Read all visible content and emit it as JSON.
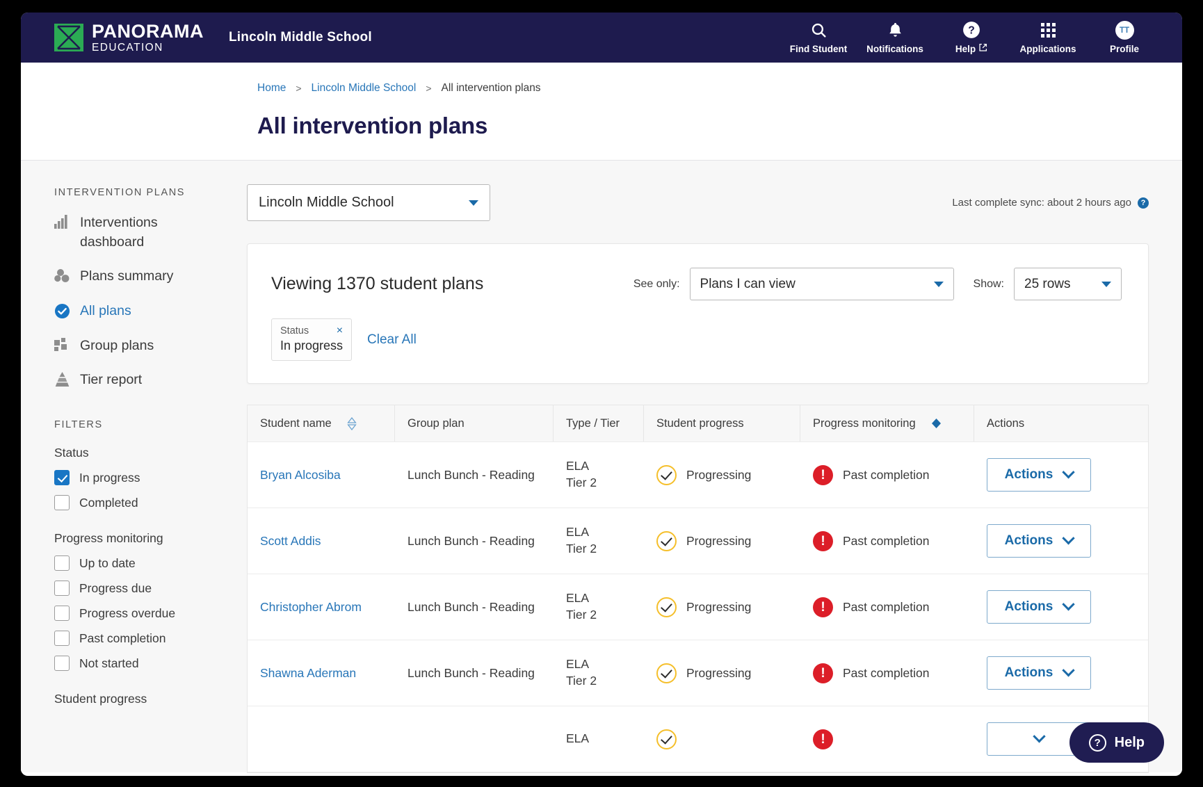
{
  "topnav": {
    "logo_line1": "PANORAMA",
    "logo_line2": "EDUCATION",
    "school": "Lincoln Middle School",
    "items": [
      {
        "icon": "search-icon",
        "label": "Find Student"
      },
      {
        "icon": "bell-icon",
        "label": "Notifications"
      },
      {
        "icon": "help-circle-icon",
        "label": "Help"
      },
      {
        "icon": "grid-icon",
        "label": "Applications"
      },
      {
        "icon": "avatar-icon",
        "label": "Profile",
        "initials": "TT"
      }
    ]
  },
  "breadcrumb": {
    "home": "Home",
    "school": "Lincoln Middle School",
    "current": "All intervention plans",
    "separator": ">"
  },
  "page_title": "All intervention plans",
  "sidebar": {
    "section_label": "INTERVENTION PLANS",
    "items": [
      {
        "label": "Interventions dashboard",
        "icon": "bar-chart-icon",
        "active": false
      },
      {
        "label": "Plans summary",
        "icon": "circles-icon",
        "active": false
      },
      {
        "label": "All plans",
        "icon": "check-circle-icon",
        "active": true
      },
      {
        "label": "Group plans",
        "icon": "squares-icon",
        "active": false
      },
      {
        "label": "Tier report",
        "icon": "pyramid-icon",
        "active": false
      }
    ],
    "filters_label": "FILTERS",
    "filter_groups": [
      {
        "title": "Status",
        "options": [
          {
            "label": "In progress",
            "checked": true
          },
          {
            "label": "Completed",
            "checked": false
          }
        ]
      },
      {
        "title": "Progress monitoring",
        "options": [
          {
            "label": "Up to date",
            "checked": false
          },
          {
            "label": "Progress due",
            "checked": false
          },
          {
            "label": "Progress overdue",
            "checked": false
          },
          {
            "label": "Past completion",
            "checked": false
          },
          {
            "label": "Not started",
            "checked": false
          }
        ]
      },
      {
        "title": "Student progress",
        "options": []
      }
    ]
  },
  "main": {
    "school_select": {
      "value": "Lincoln Middle School"
    },
    "sync_text": "Last complete sync: about 2 hours ago",
    "viewing": "Viewing 1370 student plans",
    "see_only_label": "See only:",
    "see_only_value": "Plans I can view",
    "show_label": "Show:",
    "show_value": "25 rows",
    "chip": {
      "key": "Status",
      "value": "In progress",
      "close": "×"
    },
    "clear_all": "Clear All",
    "columns": [
      {
        "label": "Student name",
        "sortable": true,
        "sort_active": false
      },
      {
        "label": "Group plan",
        "sortable": false,
        "sort_active": false
      },
      {
        "label": "Type / Tier",
        "sortable": false,
        "sort_active": false
      },
      {
        "label": "Student progress",
        "sortable": false,
        "sort_active": false
      },
      {
        "label": "Progress monitoring",
        "sortable": true,
        "sort_active": true
      },
      {
        "label": "Actions",
        "sortable": false,
        "sort_active": false
      }
    ],
    "rows": [
      {
        "student": "Bryan Alcosiba",
        "group_plan": "Lunch Bunch - Reading",
        "type": "ELA",
        "tier": "Tier 2",
        "progress": "Progressing",
        "monitoring": "Past completion",
        "action": "Actions"
      },
      {
        "student": "Scott Addis",
        "group_plan": "Lunch Bunch - Reading",
        "type": "ELA",
        "tier": "Tier 2",
        "progress": "Progressing",
        "monitoring": "Past completion",
        "action": "Actions"
      },
      {
        "student": "Christopher Abrom",
        "group_plan": "Lunch Bunch - Reading",
        "type": "ELA",
        "tier": "Tier 2",
        "progress": "Progressing",
        "monitoring": "Past completion",
        "action": "Actions"
      },
      {
        "student": "Shawna Aderman",
        "group_plan": "Lunch Bunch - Reading",
        "type": "ELA",
        "tier": "Tier 2",
        "progress": "Progressing",
        "monitoring": "Past completion",
        "action": "Actions"
      },
      {
        "student": "",
        "group_plan": "",
        "type": "ELA",
        "tier": "",
        "progress": "",
        "monitoring": "",
        "action": ""
      }
    ]
  },
  "help_fab": {
    "label": "Help"
  },
  "colors": {
    "navy": "#1e1b4e",
    "link_blue": "#2876b8",
    "accent_blue": "#1976c4",
    "brand_green": "#2bab54",
    "danger_red": "#dc1e28",
    "amber": "#f5bf2b"
  }
}
